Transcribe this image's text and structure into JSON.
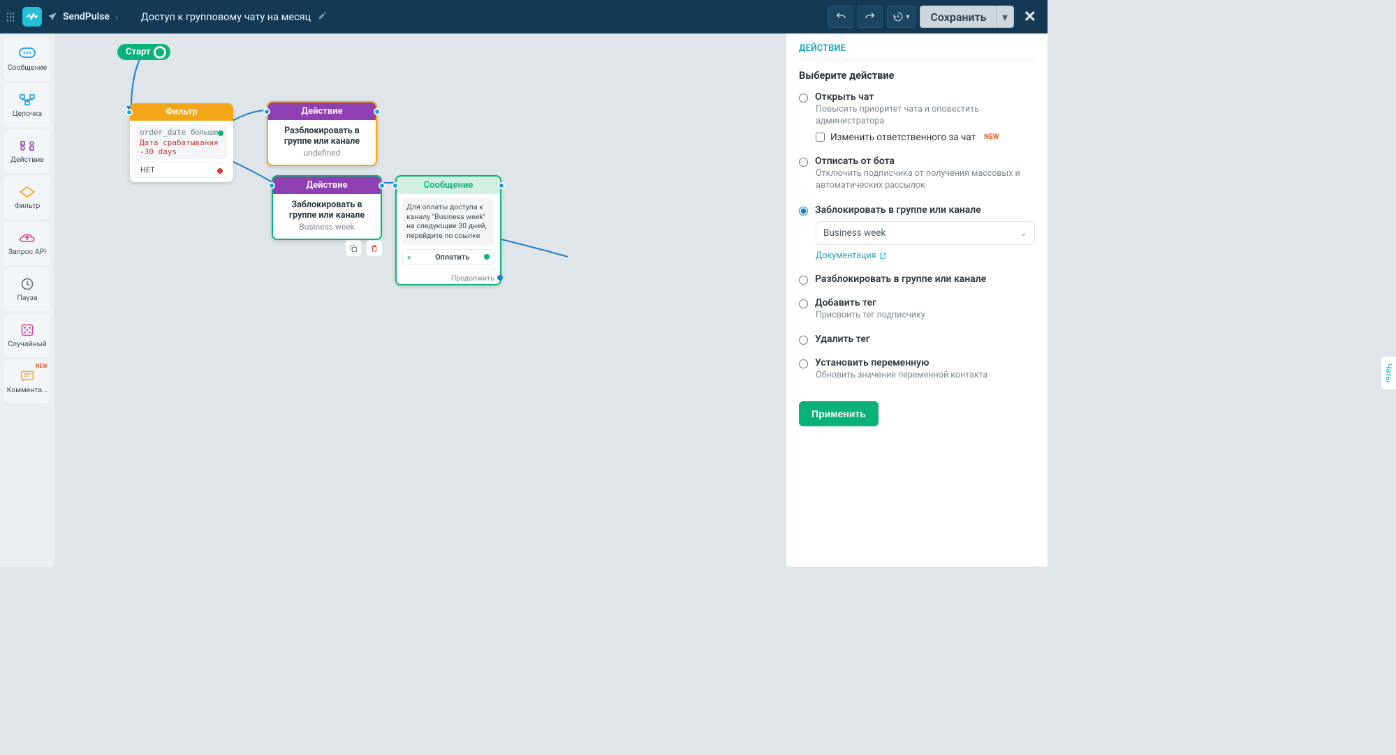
{
  "header": {
    "brand": "SendPulse",
    "title": "Доступ к групповому чату на месяц",
    "save": "Сохранить"
  },
  "sidebar": {
    "items": [
      {
        "label": "Сообщение"
      },
      {
        "label": "Цепочка"
      },
      {
        "label": "Действие"
      },
      {
        "label": "Фильтр"
      },
      {
        "label": "Запрос API"
      },
      {
        "label": "Пауза"
      },
      {
        "label": "Случайный"
      },
      {
        "label": "Коммента..."
      }
    ],
    "new_badge": "NEW"
  },
  "canvas": {
    "start": "Старт",
    "filter": {
      "header": "Фильтр",
      "var": "order_date",
      "op": "больше",
      "val": "Дата срабатывания -30 days",
      "no": "НЕТ"
    },
    "action1": {
      "header": "Действие",
      "title": "Разблокировать в группе или канале",
      "sub": "undefined"
    },
    "action2": {
      "header": "Действие",
      "title": "Заблокировать в группе или канале",
      "sub": "Business week"
    },
    "msg": {
      "header": "Сообщение",
      "text": "Для оплаты доступа к каналу \"Business week\" на следующие 30 дней, перейдите по ссылке",
      "pay": "Оплатить",
      "continue": "Продолжить"
    }
  },
  "panel": {
    "title": "ДЕЙСТВИЕ",
    "subtitle": "Выберите действие",
    "opts": {
      "open_chat": {
        "label": "Открыть чат",
        "desc": "Повысить приоритет чата и оповестить администратора",
        "check": "Изменить ответственного за чат",
        "new": "NEW"
      },
      "unsub": {
        "label": "Отписать от бота",
        "desc": "Отключить подписчика от получения массовых и автоматических рассылок"
      },
      "block": {
        "label": "Заблокировать в группе или канале",
        "select": "Business week",
        "doc": "Документация"
      },
      "unblock": {
        "label": "Разблокировать в группе или канале"
      },
      "add_tag": {
        "label": "Добавить тег",
        "desc": "Присвоить тег подписчику"
      },
      "del_tag": {
        "label": "Удалить тег"
      },
      "set_var": {
        "label": "Установить переменную",
        "desc": "Обновить значение переменной контакта"
      }
    },
    "apply": "Применить"
  },
  "chats_tab": "Чаты"
}
